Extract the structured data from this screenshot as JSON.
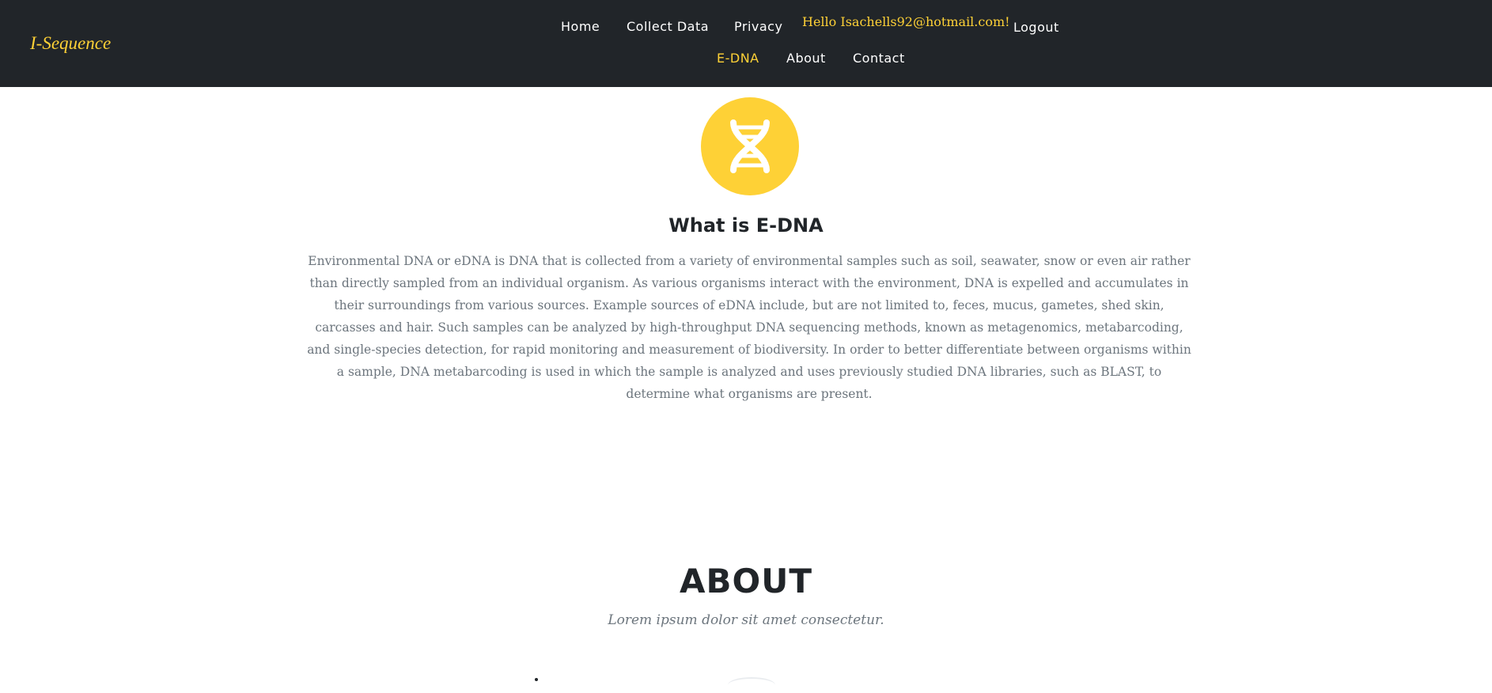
{
  "navbar": {
    "brand": "I-Sequence",
    "links": {
      "home": "Home",
      "collect_data": "Collect Data",
      "privacy": "Privacy",
      "logout": "Logout",
      "edna": "E-DNA",
      "about": "About",
      "contact": "Contact"
    },
    "greeting": "Hello Isachells92@hotmail.com!",
    "active_link": "E-DNA"
  },
  "edna": {
    "icon": "dna-icon",
    "title": "What is E-DNA",
    "text": "Environmental DNA or eDNA is DNA that is collected from a variety of environmental samples such as soil, seawater, snow or even air rather than directly sampled from an individual organism. As various organisms interact with the environment, DNA is expelled and accumulates in their surroundings from various sources. Example sources of eDNA include, but are not limited to, feces, mucus, gametes, shed skin, carcasses and hair. Such samples can be analyzed by high-throughput DNA sequencing methods, known as metagenomics, metabarcoding, and single-species detection, for rapid monitoring and measurement of biodiversity. In order to better differentiate between organisms within a sample, DNA metabarcoding is used in which the sample is analyzed and uses previously studied DNA libraries, such as BLAST, to determine what organisms are present."
  },
  "about": {
    "title": "ABOUT",
    "subtitle": "Lorem ipsum dolor sit amet consectetur."
  },
  "colors": {
    "navbar_bg": "#212529",
    "accent": "#fed136",
    "heading": "#212529",
    "muted_text": "#6c757d"
  }
}
